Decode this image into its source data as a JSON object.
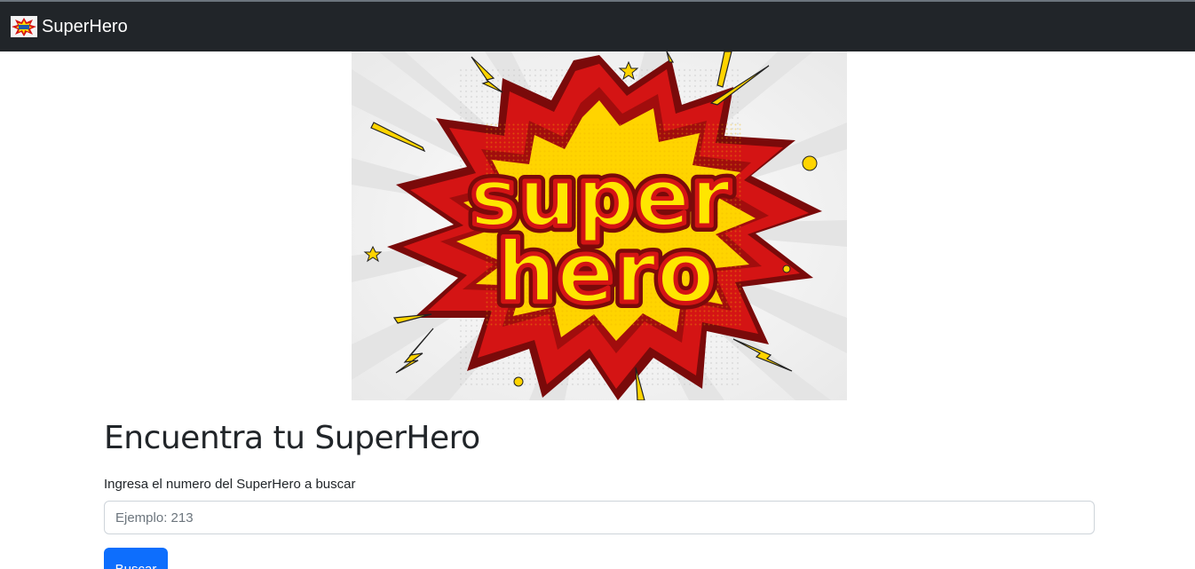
{
  "navbar": {
    "brand_text": "SuperHero",
    "logo_icon": "superhero-logo-icon"
  },
  "hero": {
    "image_icon": "superhero-comic-burst-image",
    "word_top": "super",
    "word_bottom": "hero"
  },
  "main": {
    "title": "Encuentra tu SuperHero",
    "label": "Ingresa el numero del SuperHero a buscar",
    "search_placeholder": "Ejemplo: 213",
    "search_value": "",
    "button_label": "Buscar"
  },
  "colors": {
    "navbar_bg": "#212529",
    "primary": "#0d6efd",
    "burst_red": "#d41414",
    "burst_yellow": "#ffe100"
  }
}
